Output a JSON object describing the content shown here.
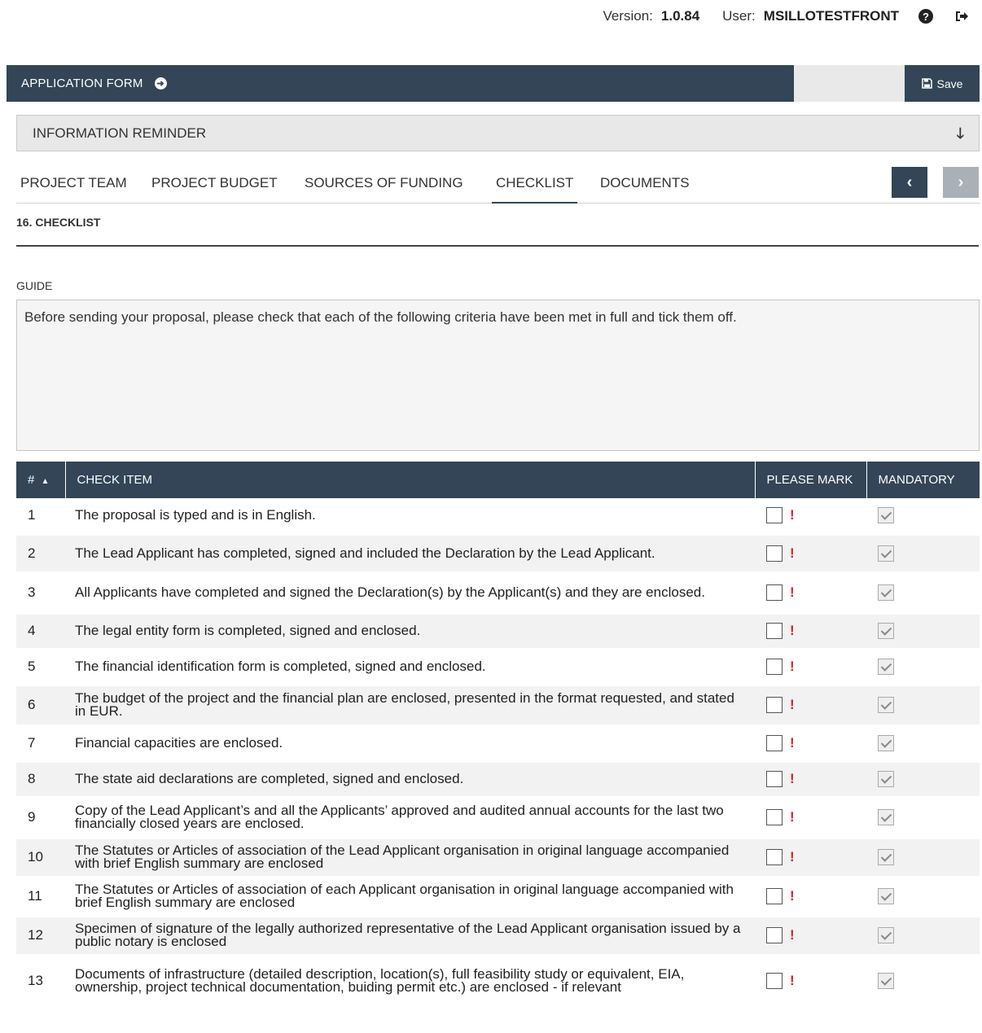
{
  "topbar": {
    "version_label": "Version:",
    "version": "1.0.84",
    "user_label": "User:",
    "user": "MSILLOTESTFRONT"
  },
  "header": {
    "title": "APPLICATION FORM",
    "save_label": "Save"
  },
  "reminder": {
    "title": "INFORMATION REMINDER"
  },
  "tabs": [
    {
      "label": "PROJECT TEAM"
    },
    {
      "label": "PROJECT BUDGET"
    },
    {
      "label": "SOURCES OF FUNDING"
    },
    {
      "label": "CHECKLIST"
    },
    {
      "label": "DOCUMENTS"
    }
  ],
  "section": {
    "title": "16. CHECKLIST"
  },
  "guide": {
    "label": "GUIDE",
    "text": "Before sending your proposal, please check that each of the following criteria have been met in full and tick them off."
  },
  "table": {
    "headers": {
      "num": "#",
      "item": "CHECK ITEM",
      "mark": "PLEASE MARK",
      "mandatory": "MANDATORY"
    },
    "rows": [
      {
        "num": "1",
        "item": "The proposal is typed and is in English."
      },
      {
        "num": "2",
        "item": "The Lead Applicant has completed, signed and included the Declaration by the Lead Applicant."
      },
      {
        "num": "3",
        "item": "All Applicants have completed and signed the Declaration(s) by the Applicant(s) and they are enclosed."
      },
      {
        "num": "4",
        "item": "The legal entity form is completed, signed and enclosed."
      },
      {
        "num": "5",
        "item": "The financial identification form is completed, signed and enclosed."
      },
      {
        "num": "6",
        "item": "The budget of the project and the financial plan are enclosed, presented in the format requested, and stated in EUR."
      },
      {
        "num": "7",
        "item": "Financial capacities are enclosed."
      },
      {
        "num": "8",
        "item": "The state aid declarations are completed, signed and enclosed."
      },
      {
        "num": "9",
        "item": "Copy of the Lead Applicant’s and all the Applicants’ approved and audited annual accounts for the last two financially closed years are enclosed."
      },
      {
        "num": "10",
        "item": "The Statutes or Articles of association of the Lead Applicant organisation in original language accompanied with brief English summary are enclosed"
      },
      {
        "num": "11",
        "item": "The Statutes or Articles of association of each Applicant organisation in original language accompanied with brief English summary are enclosed"
      },
      {
        "num": "12",
        "item": "Specimen of signature of the legally authorized representative of the Lead Applicant organisation issued by a public notary is enclosed"
      },
      {
        "num": "13",
        "item": "Documents of infrastructure (detailed description, location(s), full feasibility study or equivalent, EIA, ownership, project technical documentation, buiding permit etc.) are enclosed - if relevant"
      }
    ]
  }
}
